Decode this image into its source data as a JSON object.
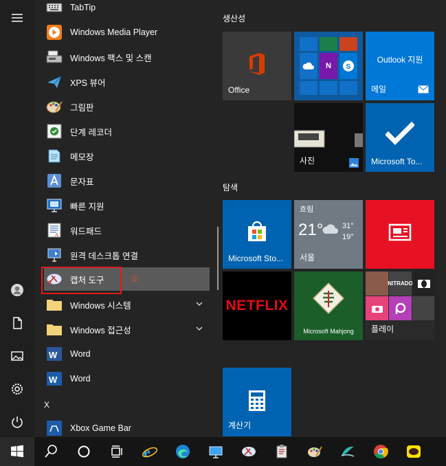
{
  "apps": [
    {
      "label": "TabTip",
      "icon": "keyboard-icon"
    },
    {
      "label": "Windows Media Player",
      "icon": "media-player-icon"
    },
    {
      "label": "Windows 팩스 및 스캔",
      "icon": "fax-scan-icon"
    },
    {
      "label": "XPS 뷰어",
      "icon": "xps-viewer-icon"
    },
    {
      "label": "그림판",
      "icon": "paint-icon"
    },
    {
      "label": "단계 레코더",
      "icon": "steps-recorder-icon"
    },
    {
      "label": "메모장",
      "icon": "notepad-icon"
    },
    {
      "label": "문자표",
      "icon": "character-map-icon"
    },
    {
      "label": "빠른 지원",
      "icon": "quick-assist-icon"
    },
    {
      "label": "워드패드",
      "icon": "wordpad-icon"
    },
    {
      "label": "원격 데스크톱 연결",
      "icon": "remote-desktop-icon"
    },
    {
      "label": "캡처 도구",
      "icon": "snipping-tool-icon"
    }
  ],
  "folders": [
    {
      "label": "Windows 시스템"
    },
    {
      "label": "Windows 접근성"
    }
  ],
  "word_items": [
    {
      "label": "Word"
    },
    {
      "label": "Word"
    }
  ],
  "section_letter": "X",
  "xbox_item": {
    "label": "Xbox Game Bar"
  },
  "marker": "①",
  "groups": {
    "productivity": "생산성",
    "explore": "탐색"
  },
  "tiles": {
    "office": "Office",
    "outlook_support": "Outlook 지원",
    "mail": "메일",
    "photos": "사진",
    "microsoft_todo": "Microsoft To...",
    "microsoft_store": "Microsoft Sto...",
    "weather_condition": "흐림",
    "weather_temp": "21°",
    "weather_high": "31°",
    "weather_low": "19°",
    "weather_city": "서울",
    "netflix": "NETFLIX",
    "mahjong": "Microsoft Mahjong",
    "play": "플레이",
    "nitrado": "NITRADO",
    "calculator": "계산기"
  },
  "colors": {
    "accent_blue": "#0063b1",
    "netflix_red": "#e50914",
    "tile_red": "#e81123",
    "highlight_box": "#e21b1b"
  }
}
